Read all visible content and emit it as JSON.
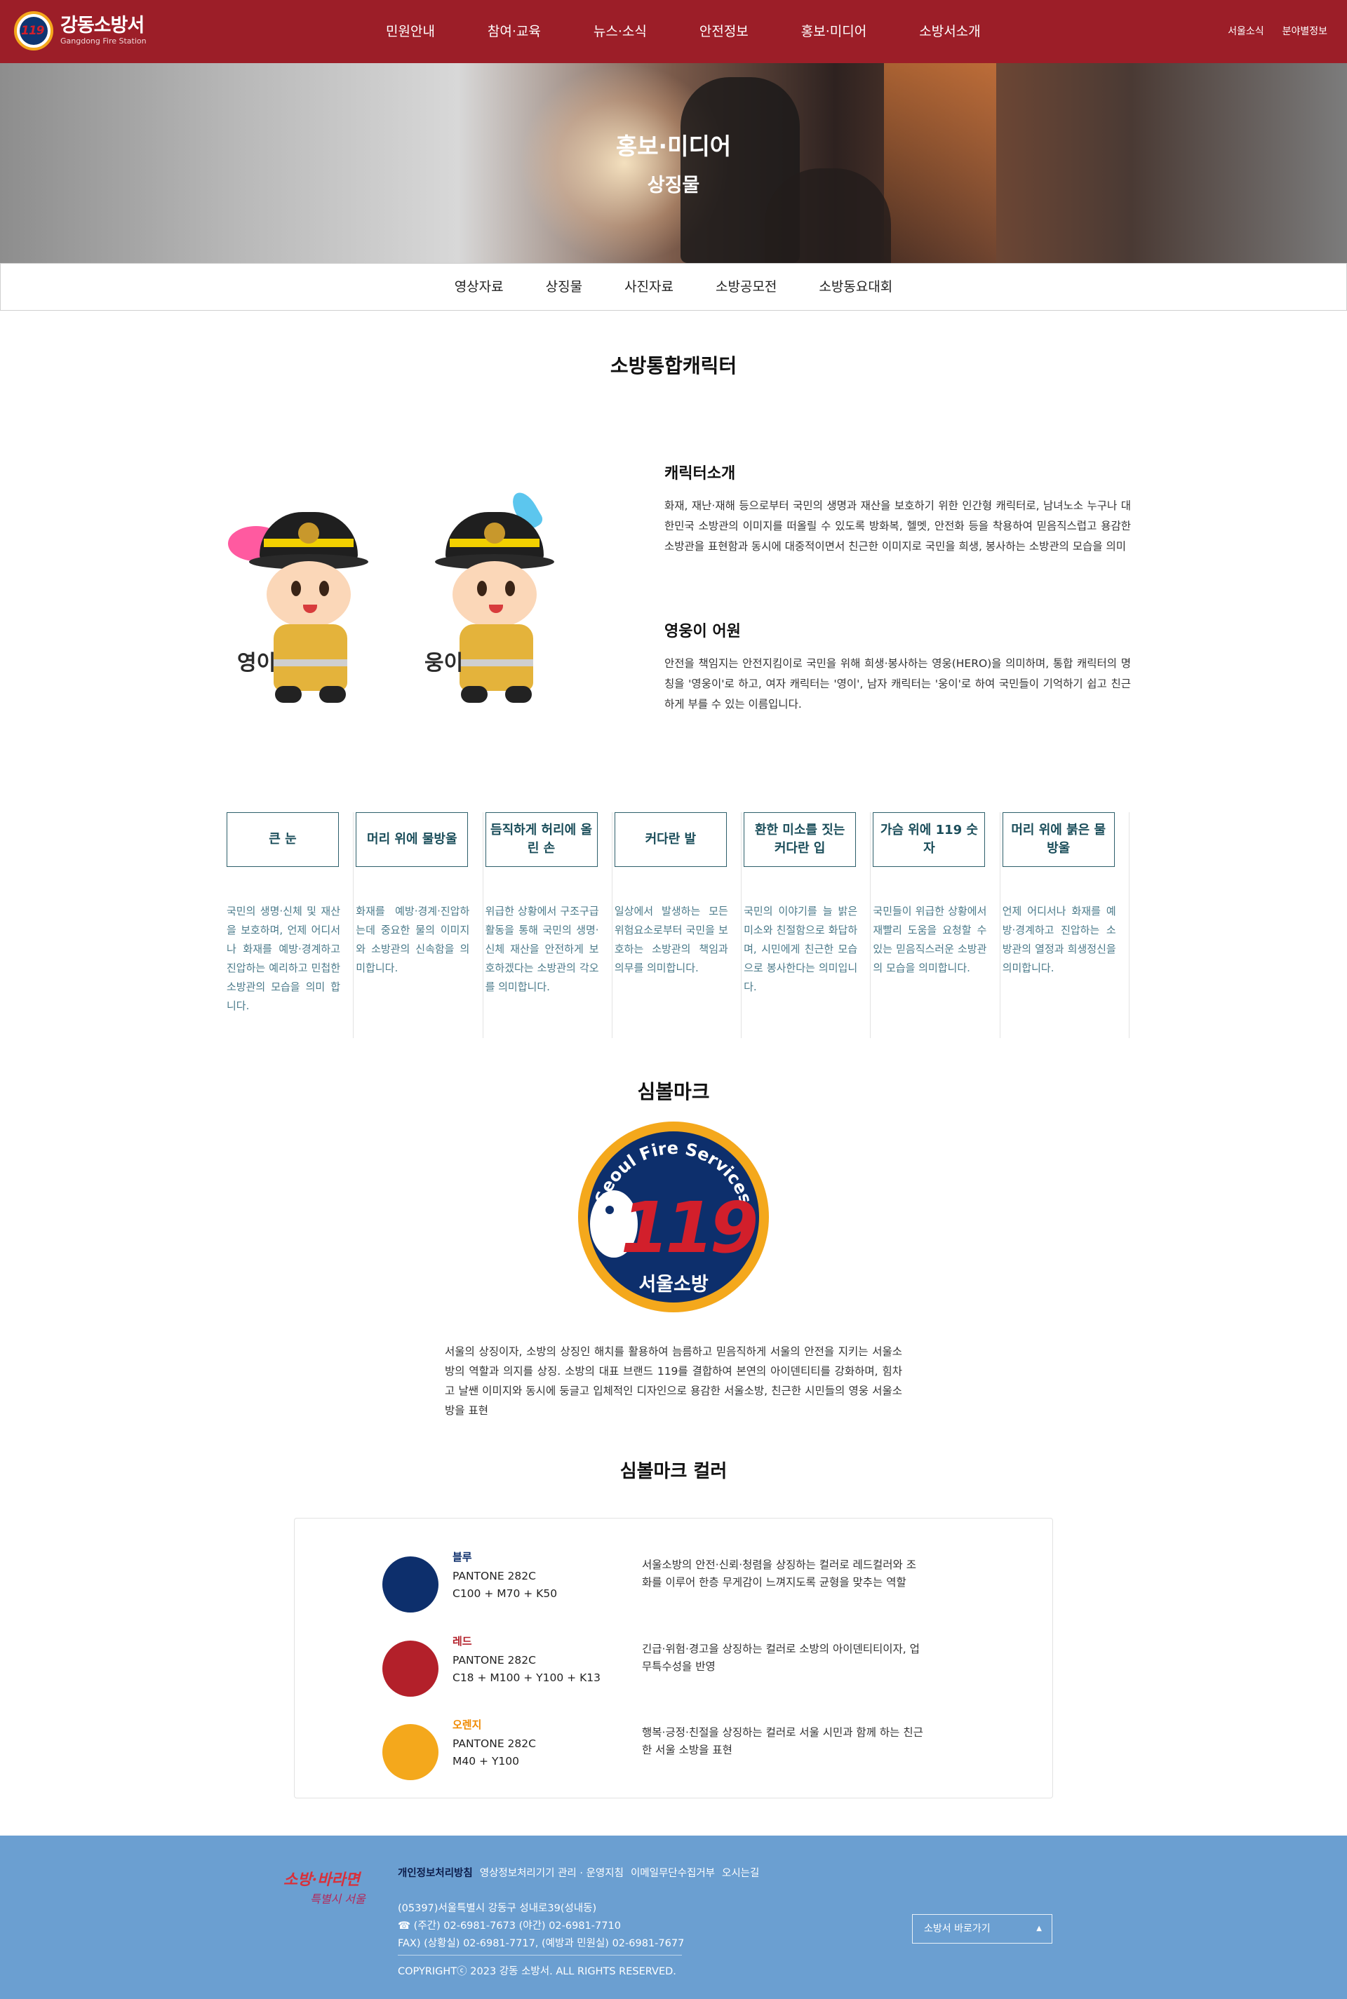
{
  "header": {
    "logo_title": "강동소방서",
    "logo_sub": "Gangdong Fire Station",
    "logo_emblem_num": "119",
    "nav": [
      "민원안내",
      "참여·교육",
      "뉴스·소식",
      "안전정보",
      "홍보·미디어",
      "소방서소개"
    ],
    "util": [
      "서울소식",
      "분야별정보"
    ]
  },
  "hero": {
    "title": "홍보·미디어",
    "subtitle": "상징물"
  },
  "subnav": [
    "영상자료",
    "상징물",
    "사진자료",
    "소방공모전",
    "소방동요대회"
  ],
  "section_character": {
    "title": "소방통합캐릭터",
    "names": [
      "영이",
      "웅이"
    ],
    "intro_heading": "캐릭터소개",
    "intro_text": "화재, 재난·재해 등으로부터 국민의 생명과 재산을 보호하기 위한 인간형 캐릭터로, 남녀노소 누구나 대한민국 소방관의 이미지를 떠올릴 수 있도록 방화복, 헬멧, 안전화 등을 착용하여 믿음직스럽고 용감한 소방관을 표현함과 동시에 대중적이면서 친근한 이미지로 국민을 희생, 봉사하는 소방관의 모습을 의미",
    "origin_heading": "영웅이 어원",
    "origin_text": "안전을 책임지는 안전지킴이로 국민을 위해 희생·봉사하는 영웅(HERO)을 의미하며, 통합 캐릭터의 명칭을 '영웅이'로 하고, 여자 캐릭터는 '영이', 남자 캐릭터는 '웅이'로 하여 국민들이 기억하기 쉽고 친근하게 부를 수 있는 이름입니다."
  },
  "features": [
    {
      "title": "큰 눈",
      "text": "국민의 생명·신체 및 재산을 보호하며, 언제 어디서나 화재를 예방·경계하고 진압하는 예리하고 민첩한 소방관의 모습을 의미 합니다."
    },
    {
      "title": "머리 위에 물방울",
      "text": "화재를 예방·경계·진압하는데 중요한 물의 이미지와 소방관의 신속함을 의미합니다."
    },
    {
      "title": "듬직하게 허리에 올린 손",
      "text": "위급한 상황에서 구조구급활동을 통해 국민의 생명·신체 재산을 안전하게 보호하겠다는 소방관의 각오를 의미합니다."
    },
    {
      "title": "커다란 발",
      "text": "일상에서 발생하는 모든 위험요소로부터 국민을 보호하는 소방관의 책임과 의무를 의미합니다."
    },
    {
      "title": "환한 미소를 짓는 커다란 입",
      "text": "국민의 이야기를 늘 밝은 미소와 친절함으로 화답하며, 시민에게 친근한 모습으로 봉사한다는 의미입니다."
    },
    {
      "title": "가슴 위에 119 숫자",
      "text": "국민들이 위급한 상황에서 재빨리 도움을 요청할 수 있는 믿음직스러운 소방관의 모습을 의미합니다."
    },
    {
      "title": "머리 위에 붉은 물방울",
      "text": "언제 어디서나 화재를 예방·경계하고 진압하는 소방관의 열정과 희생정신을 의미합니다."
    }
  ],
  "section_symbol": {
    "title": "심볼마크",
    "arc_text": "Seoul Fire Services",
    "number": "119",
    "seal_text": "서울소방",
    "text": "서울의 상징이자, 소방의 상징인 해치를 활용하여 늠름하고 믿음직하게 서울의 안전을 지키는 서울소방의 역할과 의지를 상징. 소방의 대표 브랜드 119를 결합하여 본연의 아이덴티티를 강화하며, 힘차고 날쌘 이미지와 동시에 둥글고 입체적인 디자인으로 용감한 서울소방, 친근한 시민들의 영웅 서울소방을 표현"
  },
  "section_colors": {
    "title": "심볼마크 컬러",
    "items": [
      {
        "name": "블루",
        "spec1": "PANTONE 282C",
        "spec2": "C100 + M70 + K50",
        "color": "#0d2f6c",
        "desc": "서울소방의 안전·신뢰·청렴을 상징하는 컬러로 레드컬러와 조화를 이루어 한층 무게감이 느껴지도록 균형을 맞추는 역할"
      },
      {
        "name": "레드",
        "spec1": "PANTONE 282C",
        "spec2": "C18 + M100 + Y100 + K13",
        "color": "#b3202a",
        "desc": "긴급·위험·경고을 상징하는 컬러로 소방의 아이덴티티이자, 업무특수성을 반영"
      },
      {
        "name": "오렌지",
        "spec1": "PANTONE 282C",
        "spec2": "M40 + Y100",
        "color": "#f4a81c",
        "desc": "행복·긍정·친절을 상징하는 컬러로 서울 시민과 함께 하는 친근한 서울 소방을 표현"
      }
    ]
  },
  "footer": {
    "logo_text_1": "소방·바라면",
    "logo_text_2": "특별시 서울",
    "links": [
      "개인정보처리방침",
      "영상정보처리기기 관리 · 운영지침",
      "이메일무단수집거부",
      "오시는길"
    ],
    "address": "(05397)서울특별시 강동구 성내로39(성내동)",
    "phone": "☎ (주간) 02-6981-7673 (야간) 02-6981-7710",
    "fax": "FAX) (상황실) 02-6981-7717, (예방과 민원실) 02-6981-7677",
    "copyright": "COPYRIGHTⓒ 2023 강동 소방서. ALL RIGHTS RESERVED.",
    "select_label": "소방서 바로가기"
  }
}
